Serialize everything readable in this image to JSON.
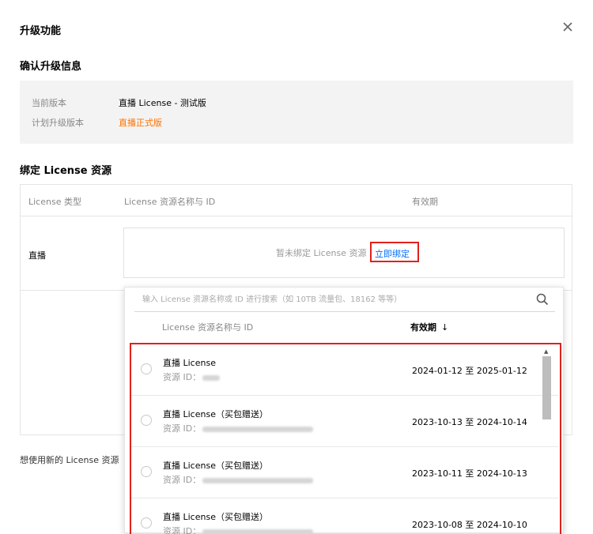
{
  "dialog": {
    "title": "升级功能"
  },
  "confirm_section": {
    "title": "确认升级信息",
    "current_label": "当前版本",
    "current_value": "直播 License - 测试版",
    "planned_label": "计划升级版本",
    "planned_value": "直播正式版"
  },
  "bind_section": {
    "title": "绑定 License 资源",
    "columns": [
      "License 类型",
      "License 资源名称与 ID",
      "有效期"
    ],
    "row_type": "直播",
    "unbound_text": "暂未绑定 License 资源",
    "bind_link": "立即绑定"
  },
  "footer_note": "想使用新的 License 资源",
  "dropdown": {
    "search_placeholder": "输入 License 资源名称或 ID 进行搜索（如 10TB 流量包、18162 等等）",
    "col_name": "License 资源名称与 ID",
    "col_validity": "有效期",
    "sort_icon": "↓",
    "id_label": "资源 ID：",
    "items": [
      {
        "name": "直播 License",
        "validity": "2024-01-12 至 2025-01-12"
      },
      {
        "name": "直播 License（买包赠送）",
        "validity": "2023-10-13 至 2024-10-14"
      },
      {
        "name": "直播 License（买包赠送）",
        "validity": "2023-10-11 至 2024-10-13"
      },
      {
        "name": "直播 License（买包赠送）",
        "validity": "2023-10-08 至 2024-10-10"
      }
    ]
  },
  "icons": {
    "close": "close-icon",
    "search": "search-icon",
    "radio": "radio-icon"
  },
  "colors": {
    "accent_orange": "#ff7200",
    "link_blue": "#006eff",
    "highlight_red": "#e1211b"
  }
}
